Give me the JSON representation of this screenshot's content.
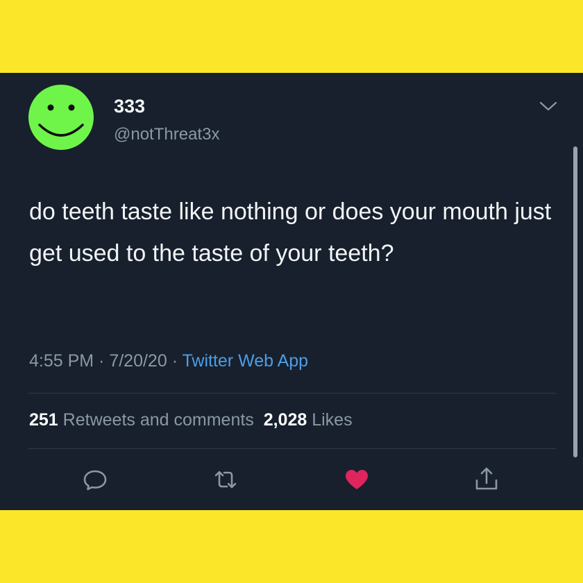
{
  "tweet": {
    "display_name": "333",
    "handle": "@notThreat3x",
    "text": "do teeth taste like nothing or does your mouth just get used to the taste of your teeth?",
    "time": "4:55 PM",
    "separator": " · ",
    "date": "7/20/20",
    "source": "Twitter Web App"
  },
  "stats": {
    "retweets_count": "251",
    "retweets_label": "Retweets and comments",
    "likes_count": "2,028",
    "likes_label": "Likes"
  },
  "icons": {
    "avatar": "smiley-face-icon",
    "menu": "chevron-down-icon",
    "reply": "speech-bubble-icon",
    "retweet": "retweet-arrows-icon",
    "like": "heart-icon",
    "share": "share-upload-icon"
  },
  "colors": {
    "background": "#fbe62a",
    "card": "#17202c",
    "avatar": "#6ff54a",
    "link": "#4e9de6",
    "like": "#e0245e",
    "muted": "#8b98a5"
  }
}
